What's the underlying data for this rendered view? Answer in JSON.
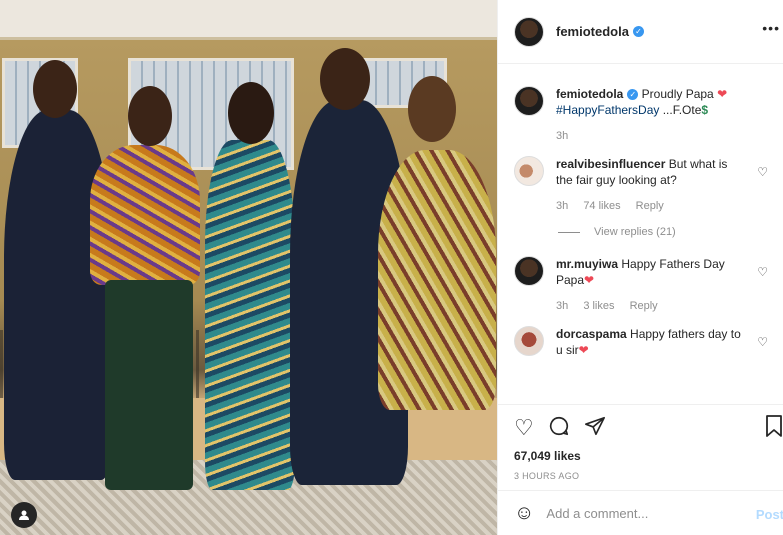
{
  "header": {
    "username": "femiotedola",
    "more": "•••"
  },
  "caption": {
    "username": "femiotedola",
    "text": " Proudly Papa ",
    "emoji": "❤",
    "hashtag": "#HappyFathersDay",
    "text2": " ...F.Ote",
    "dollar": "$",
    "time": "3h"
  },
  "comments": [
    {
      "username": "realvibesinfluencer",
      "text": " But what is the fair guy looking at?",
      "time": "3h",
      "likes": "74 likes",
      "reply": "Reply",
      "view_replies": "View replies (21)"
    },
    {
      "username": "mr.muyiwa",
      "text": " Happy Fathers Day Papa",
      "emoji": "❤",
      "time": "3h",
      "likes": "3 likes",
      "reply": "Reply"
    },
    {
      "username": "dorcaspama",
      "text": " Happy fathers day to u sir",
      "emoji": "❤"
    }
  ],
  "actions": {
    "likes": "67,049 likes",
    "timestamp": "3 HOURS AGO"
  },
  "add_comment": {
    "placeholder": "Add a comment...",
    "post_label": "Post"
  },
  "colors": {
    "verified": "#3897f0",
    "link": "#00376b",
    "heart": "#ed4956"
  }
}
